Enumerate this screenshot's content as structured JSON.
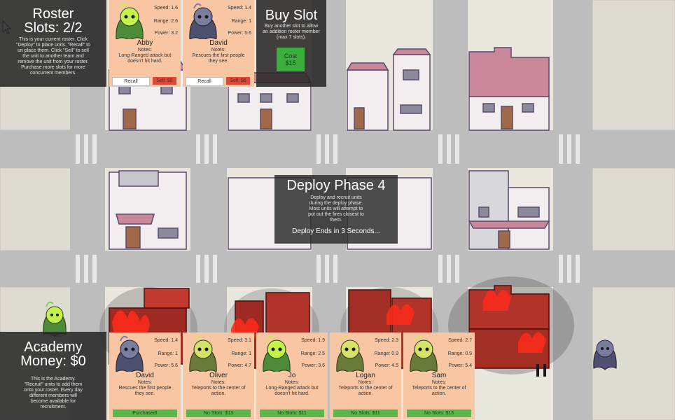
{
  "roster": {
    "title": "Roster",
    "slots": "Slots: 2/2",
    "description": "This is your current roster. Click \"Deploy\" to place units. \"Recall\" to un place them. Click \"Sell\" to sell the unit to another team and remove the unit from your roster. Purchase more slots for more concurrent members.",
    "units": [
      {
        "name": "Abby",
        "speed": "Speed: 1.6",
        "range": "Range: 2.6",
        "power": "Power: 3.2",
        "notes_label": "Notes:",
        "notes": "Long-Ranged attack but doesn't hit hard.",
        "recall": "Recall",
        "sell": "Sell: $6",
        "color": "green"
      },
      {
        "name": "David",
        "speed": "Speed: 1.4",
        "range": "Range: 1",
        "power": "Power: 5.6",
        "notes_label": "Notes:",
        "notes": "Rescues the first people they see.",
        "recall": "Recall",
        "sell": "Sell: $6",
        "color": "dark"
      }
    ]
  },
  "buy_slot": {
    "title": "Buy Slot",
    "description": "Buy another slot to allow an addition roster member (max 7 slots).",
    "button": "Cost $15"
  },
  "deploy": {
    "title": "Deploy Phase 4",
    "description": "Deploy and recruit units during the deploy phase. Most units will attempt to put out the fires closest to them.",
    "countdown": "Deploy Ends in 3 Seconds..."
  },
  "academy": {
    "title": "Academy",
    "money": "Money: $0",
    "description": "This is the Academy. \"Recruit\" units to add them onto your roster. Every day different members will become available for recruitment.",
    "units": [
      {
        "name": "David",
        "speed": "Speed: 1.4",
        "range": "Range: 1",
        "power": "Power: 5.6",
        "notes_label": "Notes:",
        "notes": "Rescues the first people they see.",
        "button": "Purchased!",
        "color": "dark"
      },
      {
        "name": "Oliver",
        "speed": "Speed: 3.1",
        "range": "Range: 1",
        "power": "Power: 4.7",
        "notes_label": "Notes:",
        "notes": "Teleports to the center of action.",
        "button": "No Slots: $13",
        "color": "olive"
      },
      {
        "name": "Jo",
        "speed": "Speed: 1.9",
        "range": "Range: 2.5",
        "power": "Power: 3.6",
        "notes_label": "Notes:",
        "notes": "Long-Ranged attack but doesn't hit hard.",
        "button": "No Slots: $11",
        "color": "green"
      },
      {
        "name": "Logan",
        "speed": "Speed: 2.3",
        "range": "Range: 0.9",
        "power": "Power: 4.5",
        "notes_label": "Notes:",
        "notes": "Teleports to the center of action.",
        "button": "No Slots: $11",
        "color": "olive"
      },
      {
        "name": "Sam",
        "speed": "Speed: 2.7",
        "range": "Range: 0.9",
        "power": "Power: 5.4",
        "notes_label": "Notes:",
        "notes": "Teleports to the center of action.",
        "button": "No Slots: $13",
        "color": "olive"
      }
    ]
  },
  "colors": {
    "card": "#f9c6a4",
    "recall": "#ffffff",
    "sell": "#d84a3a",
    "recruit": "#58b84c",
    "buy": "#3cae3c",
    "panel": "rgba(40,40,40,0.88)",
    "fire": "#b52a22"
  }
}
